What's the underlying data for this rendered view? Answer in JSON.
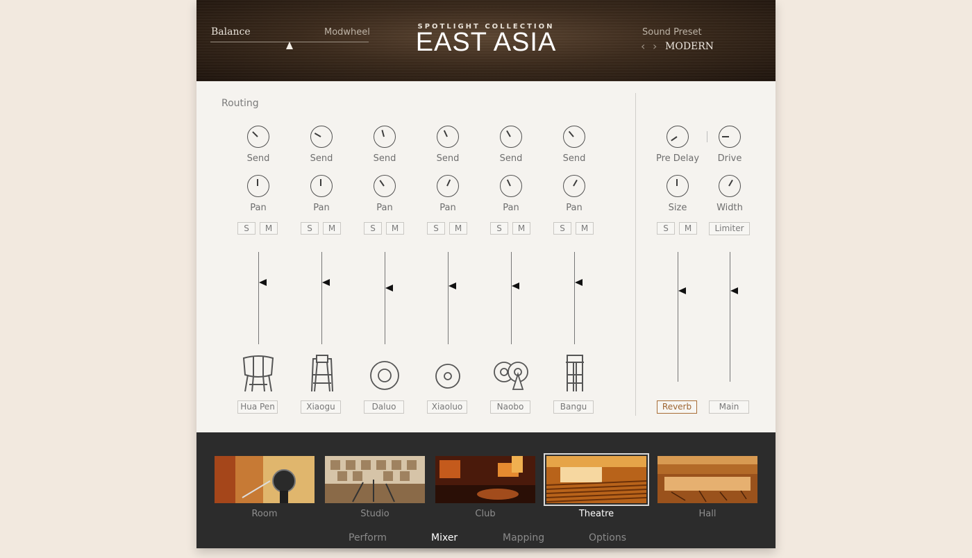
{
  "header": {
    "balance_label": "Balance",
    "modwheel_label": "Modwheel",
    "collection": "SPOTLIGHT COLLECTION",
    "title": "EAST ASIA",
    "preset_label": "Sound Preset",
    "preset_prev": "‹",
    "preset_next": "›",
    "preset_value": "MODERN"
  },
  "mixer": {
    "routing_label": "Routing",
    "solo_label": "S",
    "mute_label": "M",
    "send_label": "Send",
    "pan_label": "Pan",
    "channels": [
      {
        "name": "Hua Pen",
        "icon": "hua-pen-drum-icon"
      },
      {
        "name": "Xiaogu",
        "icon": "xiaogu-drum-icon"
      },
      {
        "name": "Daluo",
        "icon": "daluo-gong-icon"
      },
      {
        "name": "Xiaoluo",
        "icon": "xiaoluo-gong-icon"
      },
      {
        "name": "Naobo",
        "icon": "naobo-cymbals-icon"
      },
      {
        "name": "Bangu",
        "icon": "bangu-drum-icon"
      }
    ],
    "fx": {
      "pre_delay_label": "Pre Delay",
      "drive_label": "Drive",
      "size_label": "Size",
      "width_label": "Width",
      "limiter_label": "Limiter",
      "reverb_label": "Reverb",
      "main_label": "Main"
    }
  },
  "rooms": {
    "items": [
      {
        "label": "Room",
        "selected": false
      },
      {
        "label": "Studio",
        "selected": false
      },
      {
        "label": "Club",
        "selected": false
      },
      {
        "label": "Theatre",
        "selected": true
      },
      {
        "label": "Hall",
        "selected": false
      }
    ]
  },
  "nav": {
    "tabs": [
      {
        "label": "Perform",
        "active": false
      },
      {
        "label": "Mixer",
        "active": true
      },
      {
        "label": "Mapping",
        "active": false
      },
      {
        "label": "Options",
        "active": false
      }
    ]
  },
  "colors": {
    "accent": "#a86d36",
    "panel": "#f5f3ef",
    "footer": "#2c2c2c"
  }
}
